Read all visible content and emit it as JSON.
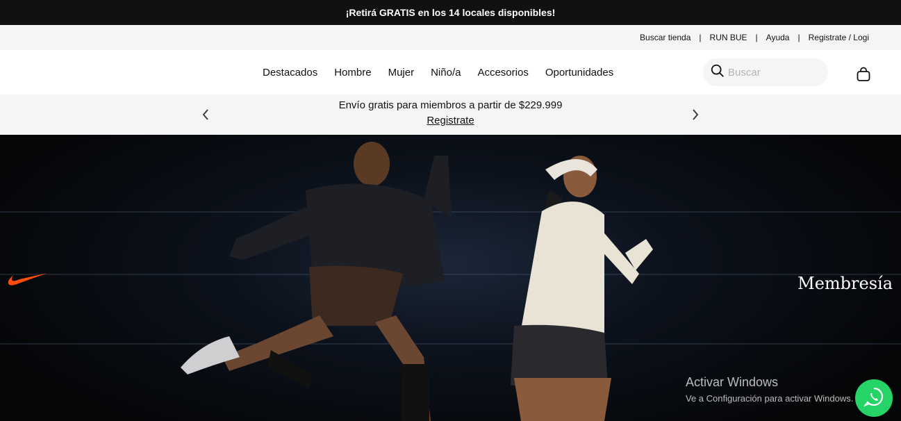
{
  "promo": {
    "text": "¡Retirá GRATIS en los 14 locales disponibles!"
  },
  "utility": {
    "find_store": "Buscar tienda",
    "run_bue": "RUN BUE",
    "help": "Ayuda",
    "register_login": "Registrate / Logi"
  },
  "nav": {
    "items": [
      {
        "label": "Destacados"
      },
      {
        "label": "Hombre"
      },
      {
        "label": "Mujer"
      },
      {
        "label": "Niño/a"
      },
      {
        "label": "Accesorios"
      },
      {
        "label": "Oportunidades"
      }
    ],
    "search": {
      "placeholder": "Buscar"
    }
  },
  "shipping": {
    "text": "Envío gratis para miembros a partir de $229.999",
    "link": "Registrate"
  },
  "hero": {
    "side_text": "Membresía"
  },
  "watermark": {
    "title": "Activar Windows",
    "subtitle": "Ve a Configuración para activar Windows."
  },
  "colors": {
    "brand_orange": "#ff4d0b",
    "whatsapp_green": "#25d366",
    "promo_bg": "#111111"
  },
  "icons": [
    "search-icon",
    "bag-icon",
    "chevron-left-icon",
    "chevron-right-icon",
    "swoosh-icon",
    "whatsapp-icon"
  ]
}
